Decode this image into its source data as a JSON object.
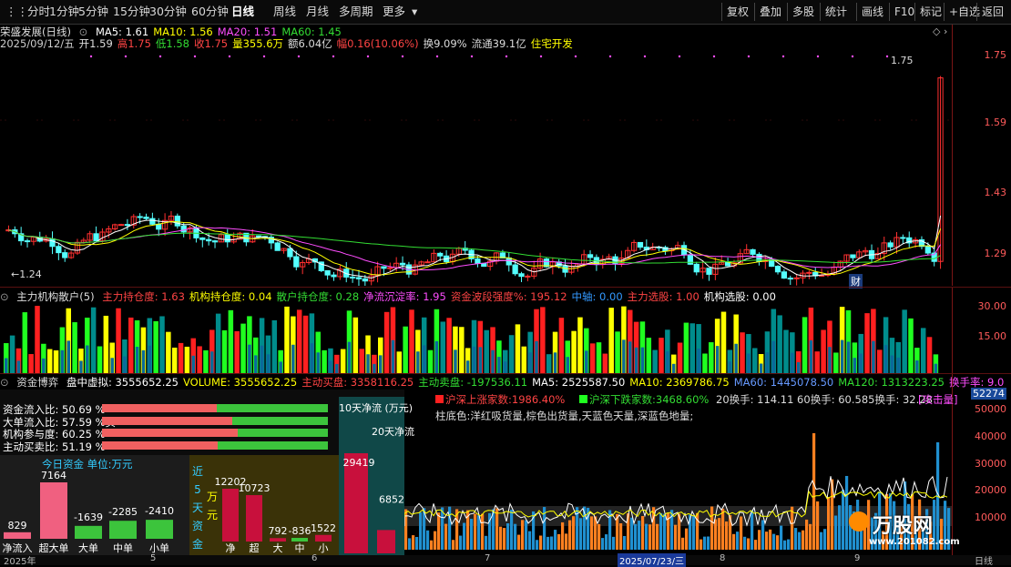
{
  "toolbar": {
    "periods": [
      "分时",
      "1分钟",
      "5分钟",
      "15分钟",
      "30分钟",
      "60分钟",
      "日线",
      "周线",
      "月线",
      "多周期",
      "更多"
    ],
    "active": "日线",
    "right": [
      "复权",
      "叠加",
      "多股",
      "统计",
      "画线",
      "F10",
      "标记",
      "+自选",
      "返回"
    ]
  },
  "stock": {
    "name": "荣盛发展(日线)",
    "ma": [
      {
        "label": "MA5: 1.61",
        "color": "#ffffff"
      },
      {
        "label": "MA10: 1.56",
        "color": "#ffff00"
      },
      {
        "label": "MA20: 1.51",
        "color": "#ff4dff"
      },
      {
        "label": "MA60: 1.45",
        "color": "#33dd33"
      }
    ],
    "quote": [
      {
        "label": "2025/09/12/五",
        "color": "#cccccc"
      },
      {
        "label": "开1.59",
        "color": "#dddddd"
      },
      {
        "label": "高1.75",
        "color": "#ff4444"
      },
      {
        "label": "低1.58",
        "color": "#33dd33"
      },
      {
        "label": "收1.75",
        "color": "#ff4444"
      },
      {
        "label": "量355.6万",
        "color": "#ffff00"
      },
      {
        "label": "额6.04亿",
        "color": "#dddddd"
      },
      {
        "label": "幅0.16(10.06%)",
        "color": "#ff4444"
      },
      {
        "label": "换9.09%",
        "color": "#dddddd"
      },
      {
        "label": "流通39.1亿",
        "color": "#dddddd"
      },
      {
        "label": "住宅开发",
        "color": "#ffff00"
      }
    ],
    "max_label": "1.75",
    "min_label": "1.24",
    "cai": "财"
  },
  "price_axis": [
    "1.75",
    "1.59",
    "1.43",
    "1.29"
  ],
  "ind1": {
    "title": "主力机构散户(5)",
    "items": [
      {
        "label": "主力持仓度: 1.63",
        "color": "#ff4444"
      },
      {
        "label": "机构持仓度: 0.04",
        "color": "#ffff00"
      },
      {
        "label": "散户持仓度: 0.28",
        "color": "#33dd33"
      },
      {
        "label": "净流沉淀率: 1.95",
        "color": "#ff4dff"
      },
      {
        "label": "资金波段强度%: 195.12",
        "color": "#ff4444"
      },
      {
        "label": "中轴: 0.00",
        "color": "#3399ff"
      },
      {
        "label": "主力选股: 1.00",
        "color": "#ff4444"
      },
      {
        "label": "机构选股: 0.00",
        "color": "#ffffff"
      }
    ],
    "axis": [
      "30.00",
      "15.00"
    ]
  },
  "ind2": {
    "title": "资金博弈",
    "items": [
      {
        "label": "盘中虚拟: 3555652.25",
        "color": "#ffffff"
      },
      {
        "label": "VOLUME: 3555652.25",
        "color": "#ffff00"
      },
      {
        "label": "主动买盘: 3358116.25",
        "color": "#ff4444"
      },
      {
        "label": "主动卖盘: -197536.11",
        "color": "#33dd33"
      },
      {
        "label": "MA5: 2525587.50",
        "color": "#ffffff"
      },
      {
        "label": "MA10: 2369786.75",
        "color": "#ffff00"
      },
      {
        "label": "MA60: 1445078.50",
        "color": "#6699ff"
      },
      {
        "label": "MA120: 1313223.25",
        "color": "#33dd33"
      },
      {
        "label": "换手率: 9.0",
        "color": "#ff4dff"
      }
    ],
    "axis": [
      "52274",
      "50000",
      "40000",
      "30000",
      "20000",
      "10000"
    ],
    "legend_up": "沪深上涨家数:1986.40%",
    "legend_down": "沪深下跌家数:3468.60%",
    "turnover": "20换手: 114.11 60换手: 60.585换手: 32.28",
    "attack": "[攻击量]",
    "note": "柱底色:洋红吸货量,棕色出货量,天蓝色天量,深蓝色地量;",
    "dates": [
      "2025年",
      "5",
      "6",
      "7",
      "2025/07/23/三",
      "8",
      "9",
      "日线"
    ]
  },
  "capital": {
    "ratios": [
      {
        "label": "资金流入比: 50.69 %",
        "value": 50.69
      },
      {
        "label": "大单流入比: 57.59 %买",
        "value": 57.59
      },
      {
        "label": "机构参与度: 60.25 %",
        "value": 60.25
      },
      {
        "label": "主动买卖比: 51.19 %",
        "value": 51.19
      }
    ],
    "today_title": "今日资金 单位:万元",
    "today": [
      {
        "name": "净流入",
        "value": 829
      },
      {
        "name": "超大单",
        "value": 7164
      },
      {
        "name": "大单",
        "value": -1639
      },
      {
        "name": "中单",
        "value": -2285
      },
      {
        "name": "小单",
        "value": -2410
      }
    ],
    "five_title": "近5天资金",
    "five_unit": "万元",
    "five": [
      {
        "name": "净",
        "value": 12202
      },
      {
        "name": "超",
        "value": 10723
      },
      {
        "name": "大",
        "value": 792
      },
      {
        "name": "中",
        "value": -836
      },
      {
        "name": "小",
        "value": 1522
      }
    ],
    "ten_title": "10天净流 (万元)",
    "ten_value": 29419,
    "twenty_title": "20天净流",
    "twenty_value": 6852
  },
  "watermark": {
    "brand": "万股网",
    "url": "www.201082.com"
  }
}
